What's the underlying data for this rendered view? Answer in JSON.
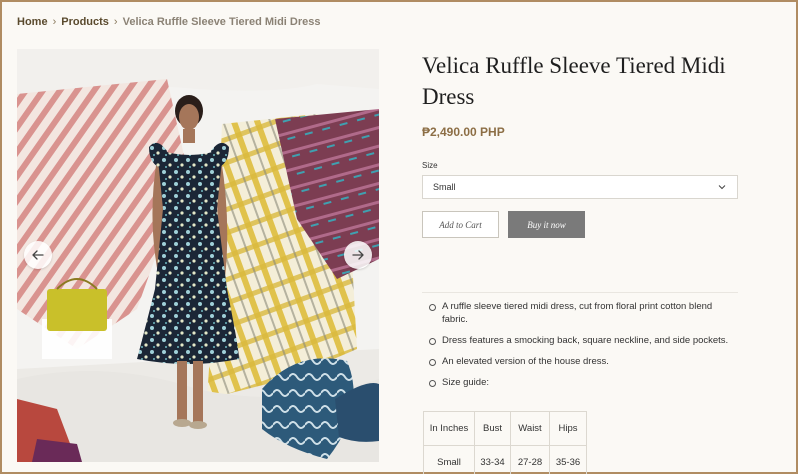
{
  "breadcrumb": {
    "home": "Home",
    "products": "Products",
    "current": "Velica Ruffle Sleeve Tiered Midi Dress",
    "separator": "›"
  },
  "gallery": {
    "prev_icon": "arrow-left-icon",
    "next_icon": "arrow-right-icon"
  },
  "product": {
    "title": "Velica Ruffle Sleeve Tiered Midi Dress",
    "price": "₱2,490.00 PHP",
    "size_label": "Size",
    "size_selected": "Small",
    "add_to_cart": "Add to Cart",
    "buy_now": "Buy it now"
  },
  "description": {
    "bullets": [
      "A ruffle sleeve tiered midi dress, cut from floral print cotton blend fabric.",
      "Dress features a smocking back, square neckline, and side pockets.",
      "An elevated version of the house dress.",
      "Size guide:"
    ]
  },
  "size_table": {
    "headers": [
      "In Inches",
      "Bust",
      "Waist",
      "Hips"
    ],
    "rows": [
      [
        "Small",
        "33-34",
        "27-28",
        "35-36"
      ]
    ]
  },
  "colors": {
    "accent": "#8c6e45",
    "breadcrumb": "#5a4a2e",
    "buy_button": "#7a7a7a",
    "frame": "#b08c62"
  }
}
